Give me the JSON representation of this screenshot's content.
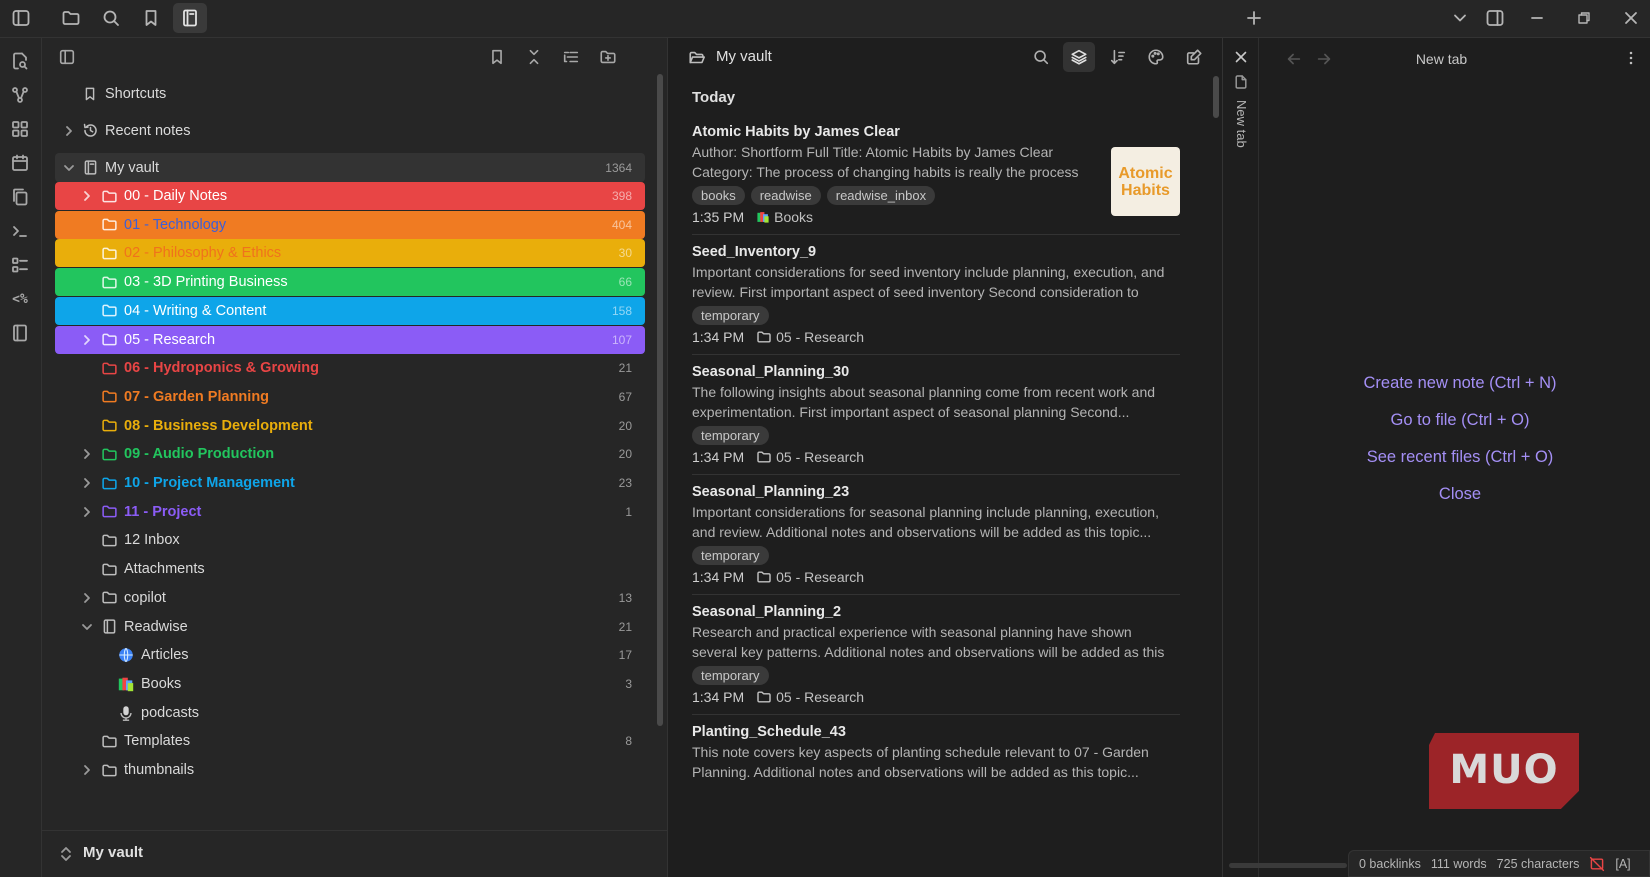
{
  "explorer": {
    "shortcuts_label": "Shortcuts",
    "recent_label": "Recent notes",
    "vault_label": "My vault",
    "vault_count": "1364",
    "folders": [
      {
        "label": "00 - Daily Notes",
        "count": "398"
      },
      {
        "label": "01 - Technology",
        "count": "404"
      },
      {
        "label": "02 - Philosophy & Ethics",
        "count": "30"
      },
      {
        "label": "03 - 3D Printing Business",
        "count": "66"
      },
      {
        "label": "04 - Writing & Content",
        "count": "158"
      },
      {
        "label": "05 - Research",
        "count": "107"
      },
      {
        "label": "06 - Hydroponics & Growing",
        "count": "21"
      },
      {
        "label": "07 - Garden Planning",
        "count": "67"
      },
      {
        "label": "08 - Business Development",
        "count": "20"
      },
      {
        "label": "09 - Audio Production",
        "count": "20"
      },
      {
        "label": "10 - Project Management",
        "count": "23"
      },
      {
        "label": "11 - Project",
        "count": "1"
      },
      {
        "label": "12 Inbox",
        "count": ""
      },
      {
        "label": "Attachments",
        "count": ""
      },
      {
        "label": "copilot",
        "count": "13"
      },
      {
        "label": "Readwise",
        "count": "21"
      },
      {
        "label": "Articles",
        "count": "17"
      },
      {
        "label": "Books",
        "count": "3"
      },
      {
        "label": "podcasts",
        "count": ""
      },
      {
        "label": "Templates",
        "count": "8"
      },
      {
        "label": "thumbnails",
        "count": ""
      }
    ],
    "footer_vault": "My vault"
  },
  "note_list": {
    "title": "My vault",
    "group_label": "Today",
    "notes": [
      {
        "title": "Atomic Habits by James Clear",
        "excerpt": "Author: Shortform Full Title: Atomic Habits by James Clear Category: The process of changing habits is really the process of...",
        "tags": [
          "books",
          "readwise",
          "readwise_inbox"
        ],
        "time": "1:35 PM",
        "folder": "Books",
        "thumbnail_text": "Atomic Habits"
      },
      {
        "title": "Seed_Inventory_9",
        "excerpt": "Important considerations for seed inventory include planning, execution, and review. First important aspect of seed inventory Second consideration to keep...",
        "tags": [
          "temporary"
        ],
        "time": "1:34 PM",
        "folder": "05 - Research"
      },
      {
        "title": "Seasonal_Planning_30",
        "excerpt": "The following insights about seasonal planning come from recent work and experimentation. First important aspect of seasonal planning Second...",
        "tags": [
          "temporary"
        ],
        "time": "1:34 PM",
        "folder": "05 - Research"
      },
      {
        "title": "Seasonal_Planning_23",
        "excerpt": "Important considerations for seasonal planning include planning, execution, and review. Additional notes and observations will be added as this topic...",
        "tags": [
          "temporary"
        ],
        "time": "1:34 PM",
        "folder": "05 - Research"
      },
      {
        "title": "Seasonal_Planning_2",
        "excerpt": "Research and practical experience with seasonal planning have shown several key patterns. Additional notes and observations will be added as this topic...",
        "tags": [
          "temporary"
        ],
        "time": "1:34 PM",
        "folder": "05 - Research"
      },
      {
        "title": "Planting_Schedule_43",
        "excerpt": "This note covers key aspects of planting schedule relevant to 07 - Garden Planning. Additional notes and observations will be added as this topic...",
        "tags": [],
        "time": "",
        "folder": ""
      }
    ]
  },
  "right_pane": {
    "tab_title": "New tab",
    "vertical_tab_label": "New tab",
    "actions": [
      "Create new note (Ctrl + N)",
      "Go to file (Ctrl + O)",
      "See recent files (Ctrl + O)",
      "Close"
    ],
    "watermark": "MUO"
  },
  "status": {
    "backlinks": "0 backlinks",
    "words": "111 words",
    "characters": "725 characters",
    "mode": "[A]"
  },
  "colors": {
    "accent": "#a48ff5",
    "red": "#e84545",
    "orange": "#f07b22",
    "yellow": "#e9ae0b",
    "green": "#22c55e",
    "blue": "#0ea5e9",
    "purple": "#8b5cf6"
  }
}
